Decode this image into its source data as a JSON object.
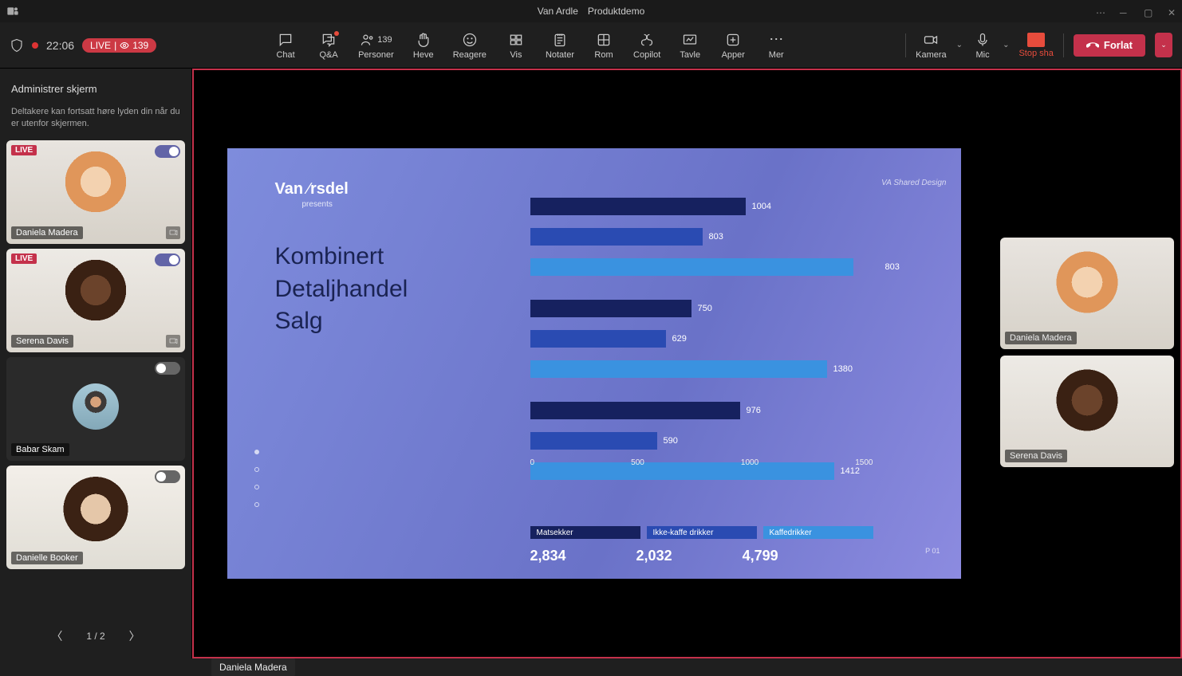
{
  "title": {
    "org": "Van Ardle",
    "meeting": "Produktdemo"
  },
  "status": {
    "shield": true,
    "recording": true,
    "timer": "22:06",
    "live_label": "LIVE",
    "viewers": 139
  },
  "toolbar": {
    "chat": "Chat",
    "qa": "Q&A",
    "people": "Personer",
    "people_count": "139",
    "raise": "Heve",
    "react": "Reagere",
    "view": "Vis",
    "notes": "Notater",
    "rooms": "Rom",
    "copilot": "Copilot",
    "board": "Tavle",
    "apps": "Apper",
    "more": "Mer",
    "camera": "Kamera",
    "mic": "Mic",
    "stop_share": "Stop sha",
    "leave": "Forlat"
  },
  "sidebar": {
    "title": "Administrer skjerm",
    "info": "Deltakere kan fortsatt høre lyden din når du er utenfor skjermen.",
    "pager": {
      "current": 1,
      "total": 2,
      "label": "1 / 2"
    }
  },
  "participants": {
    "left": [
      {
        "name": "Daniela Madera",
        "live": true,
        "toggle": true,
        "pin": true
      },
      {
        "name": "Serena Davis",
        "live": true,
        "toggle": true,
        "pin": true
      },
      {
        "name": "Babar Skam",
        "live": false,
        "toggle": false,
        "avatar_only": true
      },
      {
        "name": "Danielle Booker",
        "live": false,
        "toggle": false
      }
    ],
    "right": [
      {
        "name": "Daniela Madera"
      },
      {
        "name": "Serena Davis"
      }
    ]
  },
  "presenter_label": "Daniela Madera",
  "slide": {
    "brand": "Van Arsdel",
    "brand_sub": "presents",
    "title_lines": [
      "Kombinert",
      "Detaljhandel",
      "Salg"
    ],
    "watermark": "VA Shared Design",
    "page": "P 01",
    "legend": [
      "Matsekker",
      "Ikke-kaffe drikker",
      "Kaffedrikker"
    ],
    "totals": [
      "2,834",
      "2,032",
      "4,799"
    ]
  },
  "chart_data": {
    "type": "bar",
    "orientation": "horizontal",
    "x_axis_label": "",
    "xlim": [
      0,
      1500
    ],
    "x_ticks": [
      0,
      500,
      1000,
      1500
    ],
    "series_colors": [
      "#16215f",
      "#2a4bb2",
      "#3a92e0"
    ],
    "series": [
      "Matsekker",
      "Ikke-kaffe drikker",
      "Kaffedrikker"
    ],
    "groups": [
      {
        "values": [
          1004,
          803,
          1500
        ],
        "side_label": 803
      },
      {
        "values": [
          750,
          629,
          1380
        ]
      },
      {
        "values": [
          976,
          590,
          1412
        ]
      }
    ],
    "totals": {
      "Matsekker": 2834,
      "Ikke-kaffe drikker": 2032,
      "Kaffedrikker": 4799
    }
  }
}
